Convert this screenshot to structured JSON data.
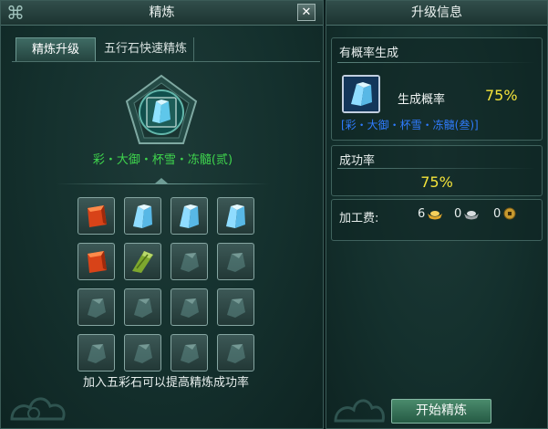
{
  "refine_window": {
    "title": "精炼",
    "close_label": "✕",
    "tabs": [
      {
        "label": "精炼升级",
        "active": true
      },
      {
        "label": "五行石快速精炼",
        "active": false
      }
    ],
    "item_name": "彩・大御・杯雪・冻髓(贰)",
    "hint": "加入五彩石可以提高精炼成功率",
    "slot_rows": [
      [
        "red-gem",
        "ice-crystal",
        "ice-crystal",
        "ice-crystal"
      ],
      [
        "red-gem",
        "green-jade",
        "empty",
        "empty"
      ],
      [
        "empty",
        "empty",
        "empty",
        "empty"
      ],
      [
        "empty",
        "empty",
        "empty",
        "empty"
      ]
    ]
  },
  "upgrade_info": {
    "title": "升级信息",
    "probability_section": {
      "title": "有概率生成",
      "label": "生成概率",
      "value": "75%",
      "result_name": "[彩・大御・杯雪・冻髓(叁)]"
    },
    "success_section": {
      "title": "成功率",
      "value": "75%"
    },
    "fee": {
      "label": "加工费:",
      "gold": "6",
      "silver": "0",
      "copper": "0"
    },
    "start_button_label": "开始精炼"
  },
  "colors": {
    "item_name": "#3fd54d",
    "result_name": "#2f7cff",
    "percent": "#f4e33a"
  }
}
